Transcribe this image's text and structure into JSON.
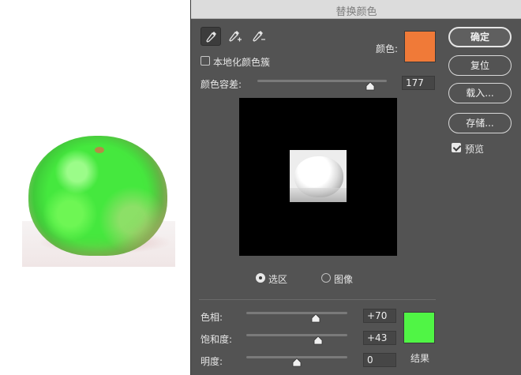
{
  "dialog": {
    "title": "替换颜色",
    "color_label": "颜色:",
    "localized_label": "本地化颜色簇",
    "localized_checked": false,
    "tolerance_label": "颜色容差:",
    "tolerance_value": "177",
    "tolerance_level": 0.87,
    "source_color": "#f07a38",
    "result_color": "#50f545",
    "result_label": "结果",
    "tools": [
      "eyedropper-icon",
      "eyedropper-plus-icon",
      "eyedropper-minus-icon"
    ],
    "radio": {
      "selection": "选区",
      "image": "图像",
      "selected": "选区"
    },
    "preview_label": "预览",
    "preview_checked": true
  },
  "buttons": {
    "ok": "确定",
    "reset": "复位",
    "load": "载入...",
    "save": "存储..."
  },
  "adjust": {
    "hue_label": "色相:",
    "hue_value": "+70",
    "hue_level": 0.69,
    "sat_label": "饱和度:",
    "sat_value": "+43",
    "sat_level": 0.71,
    "light_label": "明度:",
    "light_value": "0",
    "light_level": 0.5
  }
}
